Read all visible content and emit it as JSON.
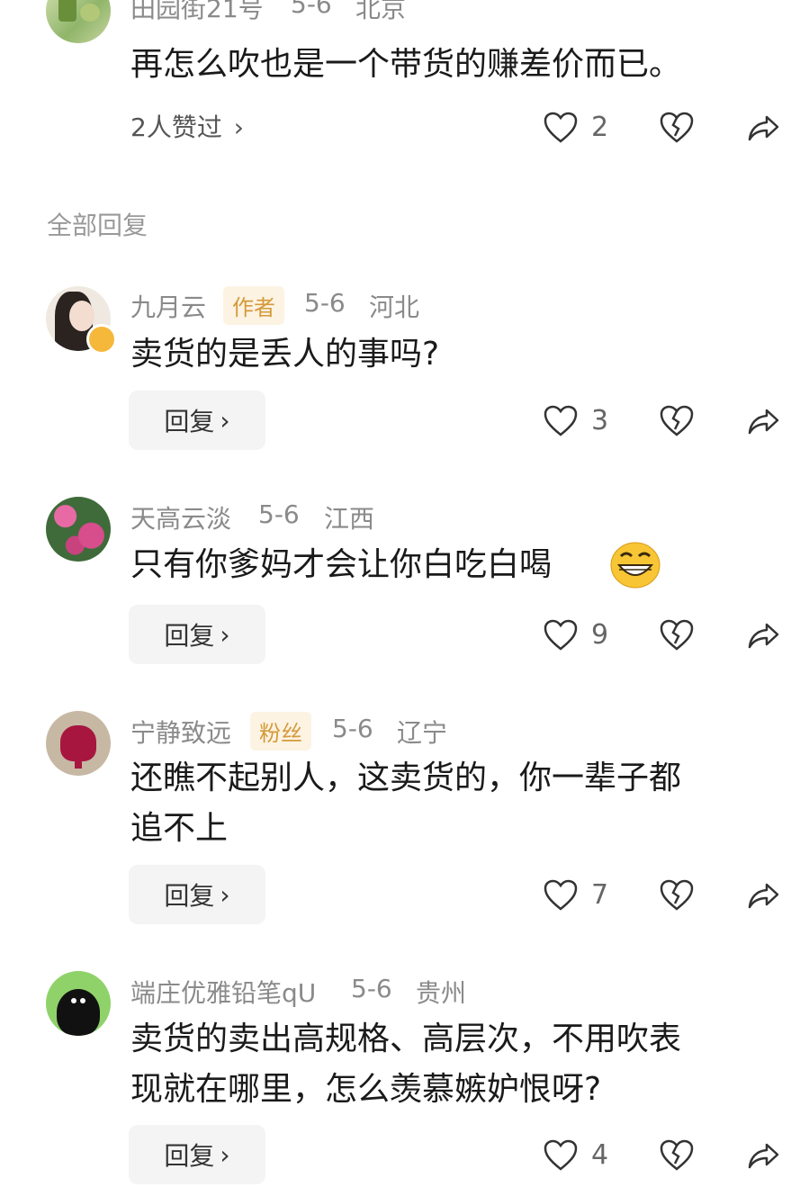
{
  "top_comment": {
    "name": "田园街21号",
    "date": "5-6",
    "location": "北京",
    "text": "再怎么吹也是一个带货的赚差价而已。",
    "likes_link": "2人赞过",
    "like_count": "2"
  },
  "section_title": "全部回复",
  "replies": [
    {
      "name": "九月云",
      "badge": "作者",
      "date": "5-6",
      "location": "河北",
      "text": "卖货的是丢人的事吗?",
      "reply_label": "回复",
      "like_count": "3"
    },
    {
      "name": "天高云淡",
      "date": "5-6",
      "location": "江西",
      "text": "只有你爹妈才会让你白吃白喝",
      "reply_label": "回复",
      "like_count": "9"
    },
    {
      "name": "宁静致远",
      "badge": "粉丝",
      "date": "5-6",
      "location": "辽宁",
      "text_line1": "还瞧不起别人，这卖货的，你一辈子都",
      "text_line2": "追不上",
      "reply_label": "回复",
      "like_count": "7"
    },
    {
      "name": "端庄优雅铅笔qU",
      "date": "5-6",
      "location": "贵州",
      "text_line1": "卖货的卖出高规格、高层次，不用吹表",
      "text_line2": "现就在哪里，怎么羡慕嫉妒恨呀?",
      "reply_label": "回复",
      "like_count": "4"
    }
  ],
  "icons": {
    "like": "heart-outline-icon",
    "dislike": "broken-heart-icon",
    "share": "share-arrow-icon",
    "emoji": "grinning-emoji-icon"
  }
}
